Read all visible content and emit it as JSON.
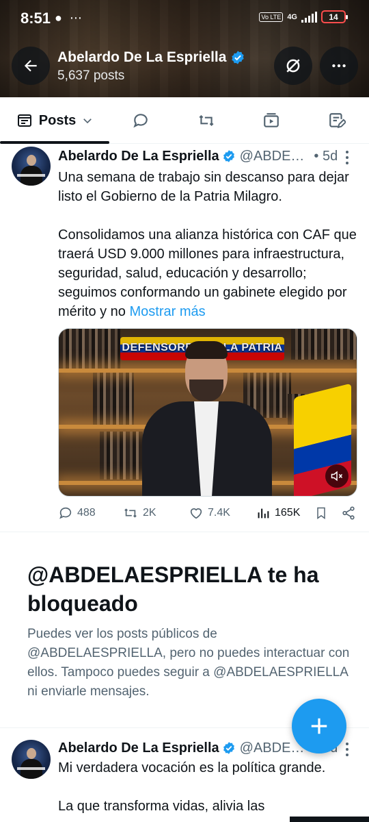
{
  "status_bar": {
    "time": "8:51",
    "left_icons": "● ⋯",
    "network": "4G",
    "volte": "Vo LTE",
    "battery": "14"
  },
  "header": {
    "name": "Abelardo De La Espriella",
    "posts_count": "5,637 posts",
    "verified": true
  },
  "tabs": {
    "posts_label": "Posts"
  },
  "tweet1": {
    "name": "Abelardo De La Espriella",
    "handle": "@ABDE…",
    "time": "• 5d",
    "text": "Una semana de trabajo sin descanso para dejar listo el Gobierno de la Patria Milagro.\n\nConsolidamos una alianza histórica con CAF que traerá USD 9.000 millones para infraestructura, seguridad, salud, educación y desarrollo; seguimos conformando un gabinete elegido por mérito y no ",
    "show_more": "Mostrar más",
    "media_sign": "DEFENSORES DE LA PATRIA",
    "replies": "488",
    "reposts": "2K",
    "likes": "7.4K",
    "views": "165K"
  },
  "blocked": {
    "title": "@ABDELAESPRIELLA te ha bloqueado",
    "description": "Puedes ver los posts públicos de @ABDELAESPRIELLA, pero no puedes interactuar con ellos. Tampoco puedes seguir a @ABDELAESPRIELLA ni enviarle mensajes."
  },
  "tweet2": {
    "name": "Abelardo De La Espriella",
    "handle": "@ABDE…",
    "time": "• 5d",
    "text": "Mi verdadera vocación es la política grande.\n\nLa que transforma vidas, alivia las"
  },
  "colors": {
    "accent": "#1d9bf0",
    "text": "#0f1419",
    "muted": "#536471"
  }
}
